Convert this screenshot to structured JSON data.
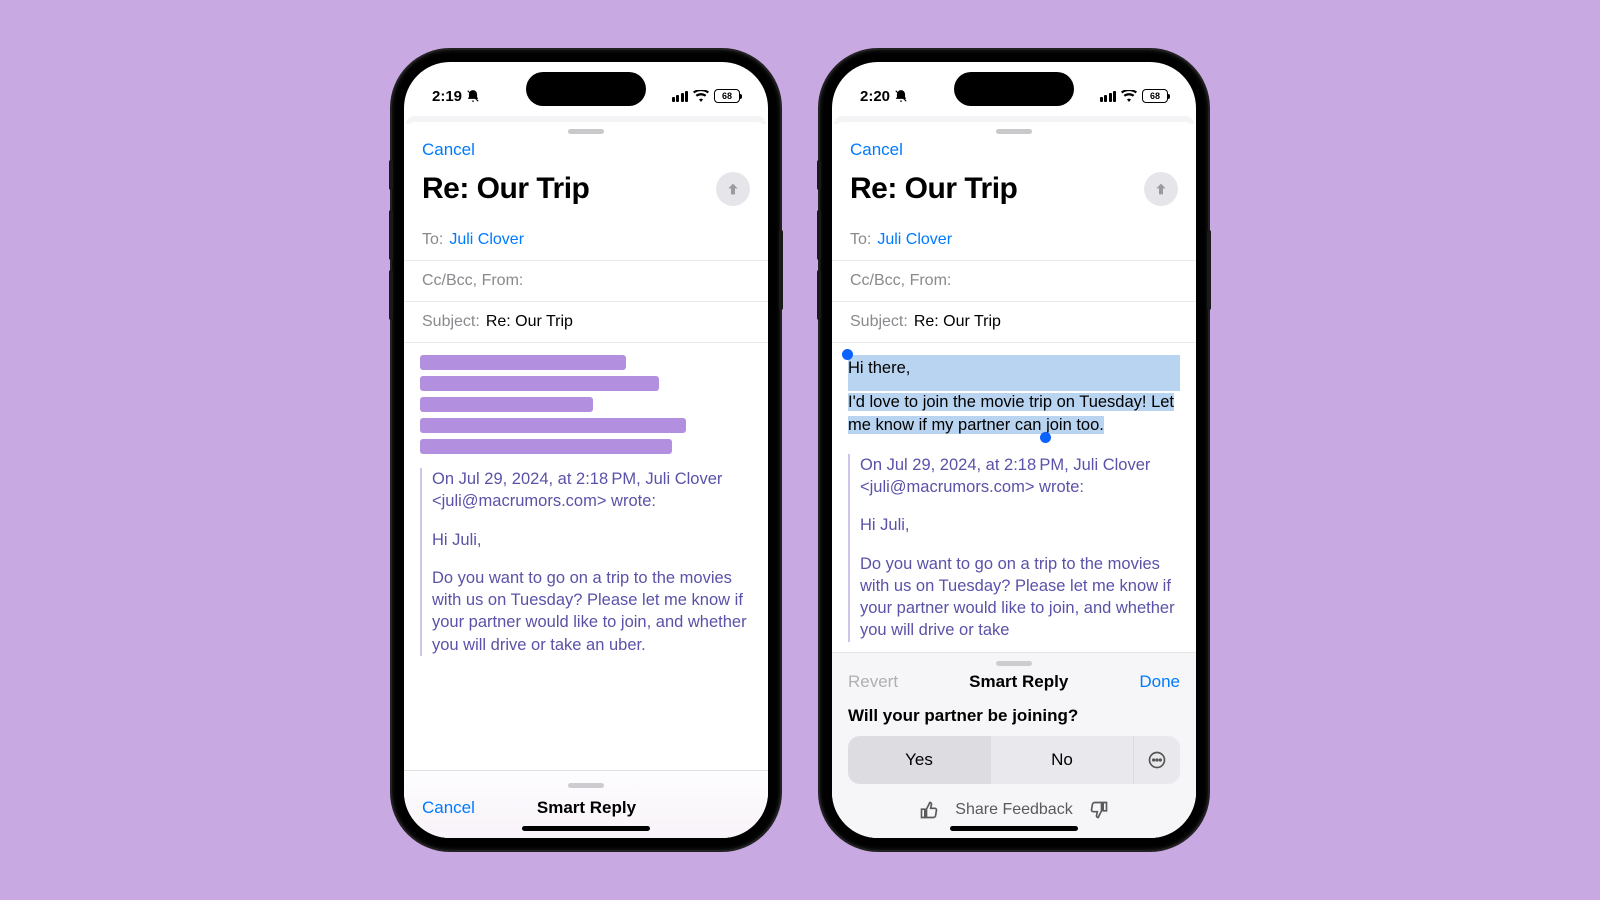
{
  "left": {
    "status": {
      "time": "2:19",
      "battery": "68"
    },
    "cancel": "Cancel",
    "title": "Re: Our Trip",
    "to_label": "To:",
    "to_name": "Juli Clover",
    "ccbcc_label": "Cc/Bcc, From:",
    "subject_label": "Subject:",
    "subject_value": "Re: Our Trip",
    "skeleton_widths": [
      "62%",
      "72%",
      "52%",
      "80%",
      "76%"
    ],
    "quote_header": "On Jul 29, 2024, at 2:18 PM, Juli Clover <juli@macrumors.com> wrote:",
    "quote_greeting": "Hi Juli,",
    "quote_body": "Do you want to go on a trip to the movies with us on Tuesday? Please let me know if your partner would like to join, and whether you will drive or take an uber.",
    "bottom": {
      "cancel": "Cancel",
      "title": "Smart Reply"
    }
  },
  "right": {
    "status": {
      "time": "2:20",
      "battery": "68"
    },
    "cancel": "Cancel",
    "title": "Re: Our Trip",
    "to_label": "To:",
    "to_name": "Juli Clover",
    "ccbcc_label": "Cc/Bcc, From:",
    "subject_label": "Subject:",
    "subject_value": "Re: Our Trip",
    "reply_greeting": "Hi there,",
    "reply_body": "I'd love to join the movie trip on Tuesday! Let me know if my partner can join too.",
    "quote_header": "On Jul 29, 2024, at 2:18 PM, Juli Clover <juli@macrumors.com> wrote:",
    "quote_greeting": "Hi Juli,",
    "quote_body": "Do you want to go on a trip to the movies with us on Tuesday? Please let me know if your partner would like to join, and whether you will drive or take",
    "panel": {
      "revert": "Revert",
      "title": "Smart Reply",
      "done": "Done",
      "question": "Will your partner be joining?",
      "yes": "Yes",
      "no": "No",
      "feedback": "Share Feedback"
    }
  }
}
